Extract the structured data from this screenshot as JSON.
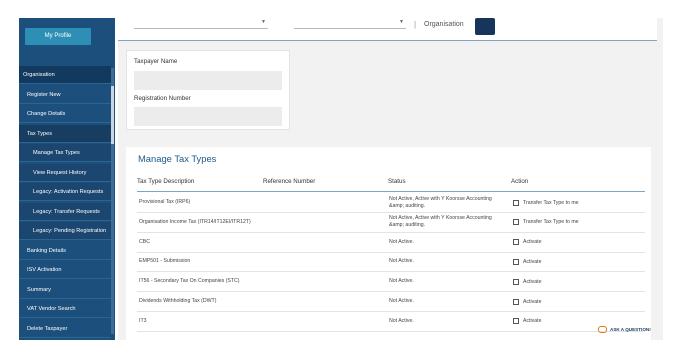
{
  "sidebar": {
    "profile_button": "My Profile",
    "items": [
      {
        "label": "Organisation",
        "type": "org"
      },
      {
        "label": "Register New",
        "type": "main"
      },
      {
        "label": "Change Details",
        "type": "main"
      },
      {
        "label": "Tax Types",
        "type": "active"
      },
      {
        "label": "Manage Tax Types",
        "type": "sub"
      },
      {
        "label": "View Request History",
        "type": "sub"
      },
      {
        "label": "Legacy: Activation Requests",
        "type": "sub"
      },
      {
        "label": "Legacy: Transfer Requests",
        "type": "sub"
      },
      {
        "label": "Legacy: Pending Registration",
        "type": "sub"
      },
      {
        "label": "Banking Details",
        "type": "main"
      },
      {
        "label": "ISV Activation",
        "type": "main"
      },
      {
        "label": "Summary",
        "type": "main"
      },
      {
        "label": "VAT Vendor Search",
        "type": "main"
      },
      {
        "label": "Delete Taxpayer",
        "type": "main"
      }
    ]
  },
  "topbar": {
    "select1_value": "",
    "select2_value": "",
    "separator": "|",
    "org_label": "Organisation"
  },
  "taxpayer": {
    "name_label": "Taxpayer Name",
    "name_value": "",
    "reg_label": "Registration Number",
    "reg_value": ""
  },
  "manage": {
    "title": "Manage Tax Types",
    "columns": [
      "Tax Type Description",
      "Reference Number",
      "Status",
      "Action"
    ],
    "rows": [
      {
        "desc": "Provisional Tax (IRP6)",
        "ref": "",
        "status": "Not Active, Active with Y Koorsse Accounting &amp; auditing.",
        "action": "Transfer Tax Type to me"
      },
      {
        "desc": "Organisation Income Tax (ITR14/IT12EI/ITR12T)",
        "ref": "",
        "status": "Not Active, Active with Y Koorsse Accounting &amp; auditing.",
        "action": "Transfer Tax Type to me"
      },
      {
        "desc": "CBC",
        "ref": "",
        "status": "Not Active.",
        "action": "Activate"
      },
      {
        "desc": "EMP501 - Submission",
        "ref": "",
        "status": "Not Active.",
        "action": "Activate"
      },
      {
        "desc": "IT56 - Secondary Tax On Companies (STC)",
        "ref": "",
        "status": "Not Active.",
        "action": "Activate"
      },
      {
        "desc": "Dividends Withholding Tax (DWT)",
        "ref": "",
        "status": "Not Active.",
        "action": "Activate"
      },
      {
        "desc": "IT3",
        "ref": "",
        "status": "Not Active.",
        "action": "Activate"
      }
    ]
  },
  "help": {
    "label": "ASK A QUESTION!"
  },
  "colors": {
    "sidebar": "#1d4f7c",
    "accent": "#2d8fb6",
    "title": "#1d5a8c"
  }
}
